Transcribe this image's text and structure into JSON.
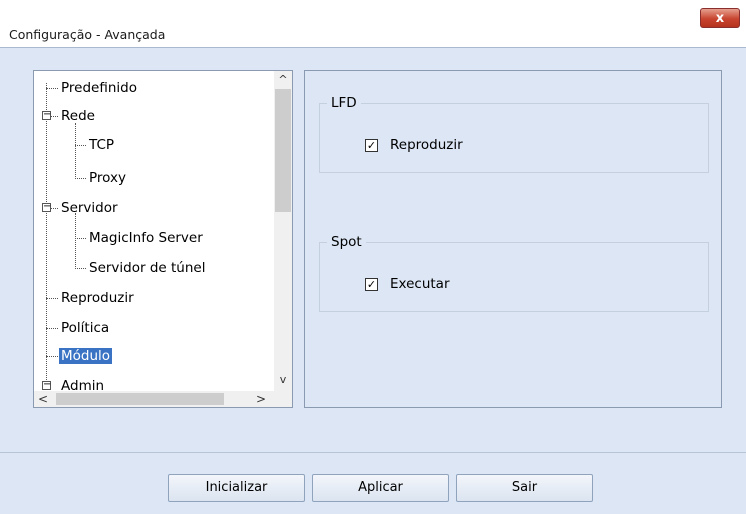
{
  "window": {
    "title": "Configuração - Avançada",
    "close_label": "x"
  },
  "tree": {
    "items": [
      {
        "label": "Predefinido",
        "level": 0,
        "expander": false
      },
      {
        "label": "Rede",
        "level": 0,
        "expander": true
      },
      {
        "label": "TCP",
        "level": 1,
        "expander": false
      },
      {
        "label": "Proxy",
        "level": 1,
        "expander": false
      },
      {
        "label": "Servidor",
        "level": 0,
        "expander": true
      },
      {
        "label": "MagicInfo Server",
        "level": 1,
        "expander": false
      },
      {
        "label": "Servidor de túnel",
        "level": 1,
        "expander": false
      },
      {
        "label": "Reproduzir",
        "level": 0,
        "expander": false
      },
      {
        "label": "Política",
        "level": 0,
        "expander": false
      },
      {
        "label": "Módulo",
        "level": 0,
        "expander": false,
        "selected": true
      },
      {
        "label": "Admin",
        "level": 0,
        "expander": true
      }
    ],
    "scroll_up": "^",
    "scroll_down": "v",
    "scroll_left": "<",
    "scroll_right": ">"
  },
  "settings": {
    "lfd_group": {
      "title": "LFD",
      "checkbox_label": "Reproduzir",
      "checked": true
    },
    "spot_group": {
      "title": "Spot",
      "checkbox_label": "Executar",
      "checked": true
    },
    "check_mark": "✓"
  },
  "buttons": {
    "initialize": "Inicializar",
    "apply": "Aplicar",
    "exit": "Sair"
  },
  "colors": {
    "client_bg": "#dce6f4",
    "selection": "#3b73c4",
    "close_button": "#c8442f"
  }
}
